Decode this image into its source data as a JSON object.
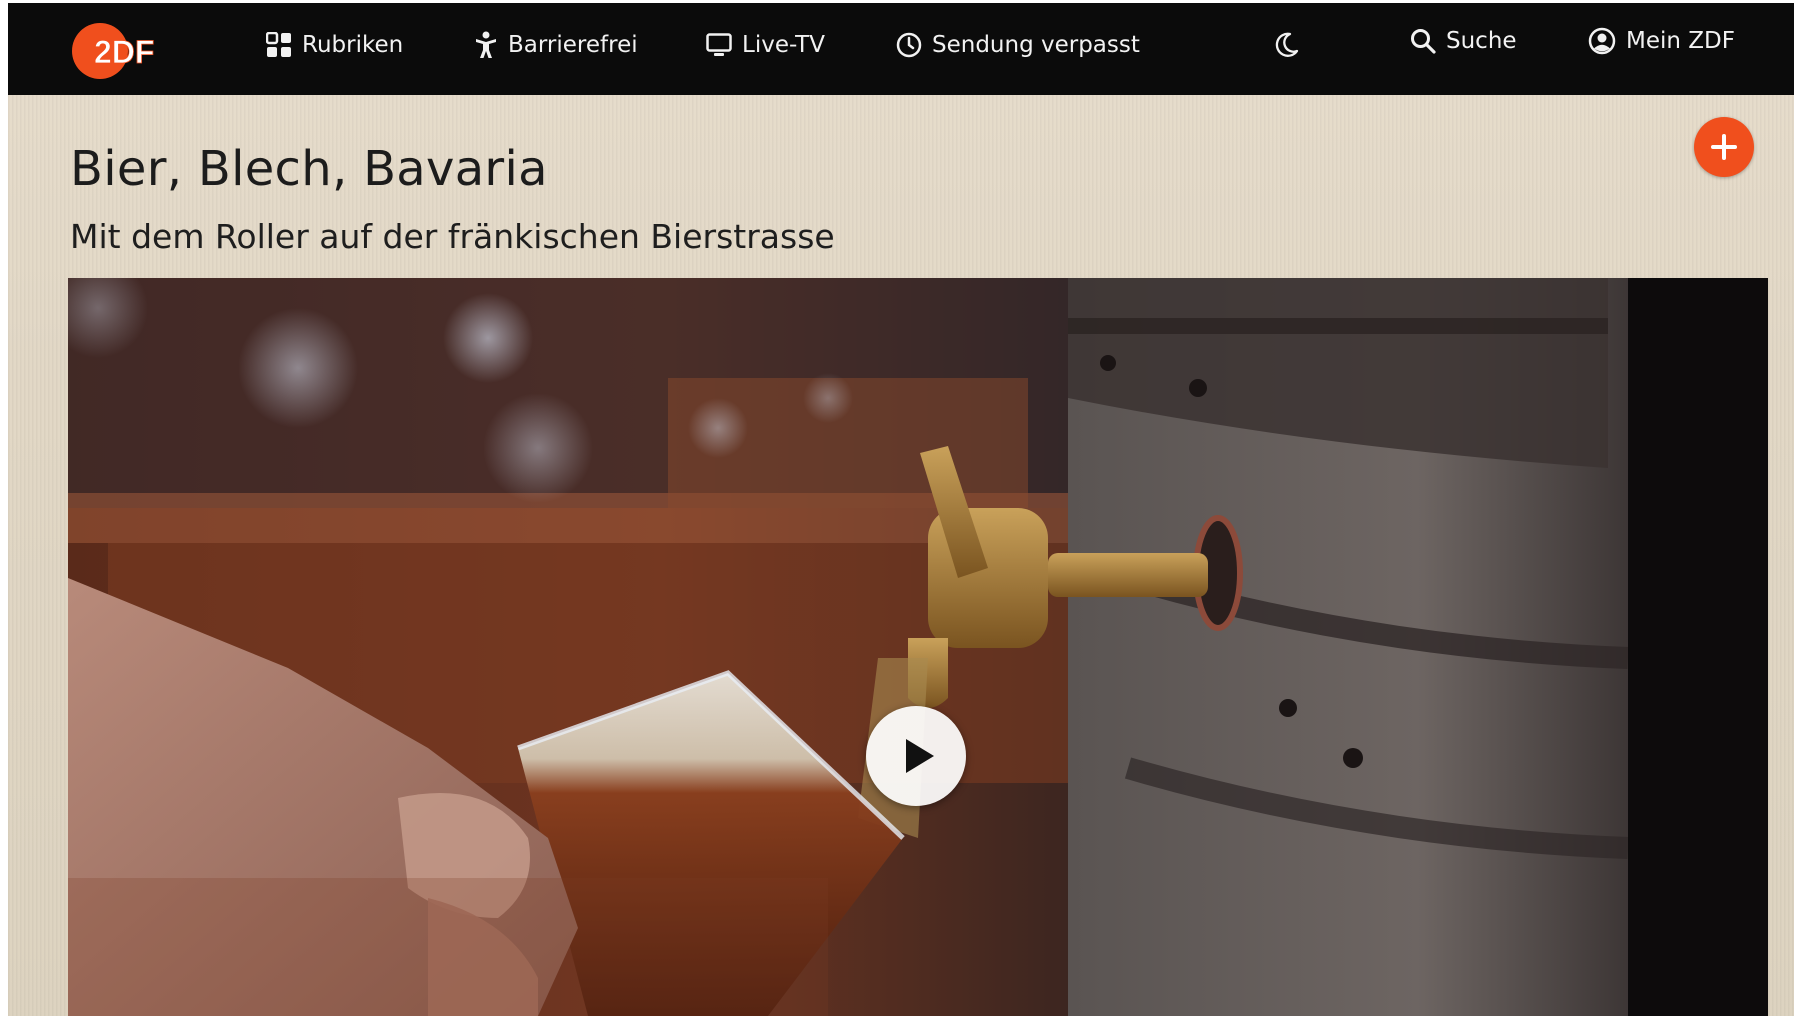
{
  "header": {
    "logo_text": "2DF",
    "nav": [
      {
        "label": "Rubriken",
        "icon": "grid-icon"
      },
      {
        "label": "Barrierefrei",
        "icon": "accessibility-icon"
      },
      {
        "label": "Live-TV",
        "icon": "tv-icon"
      },
      {
        "label": "Sendung verpasst",
        "icon": "clock-icon"
      }
    ],
    "dark_mode_icon": "moon-icon",
    "search": {
      "label": "Suche",
      "icon": "search-icon"
    },
    "account": {
      "label": "Mein ZDF",
      "icon": "user-icon"
    }
  },
  "page": {
    "title": "Bier, Blech, Bavaria",
    "subtitle": "Mit dem Roller auf der fränkischen Bierstrasse",
    "add_icon": "plus-icon"
  },
  "video": {
    "play_icon": "play-icon"
  },
  "colors": {
    "brand": "#f04f1d",
    "nav_background": "#0b0b0b",
    "content_background": "#e2d8c6"
  }
}
